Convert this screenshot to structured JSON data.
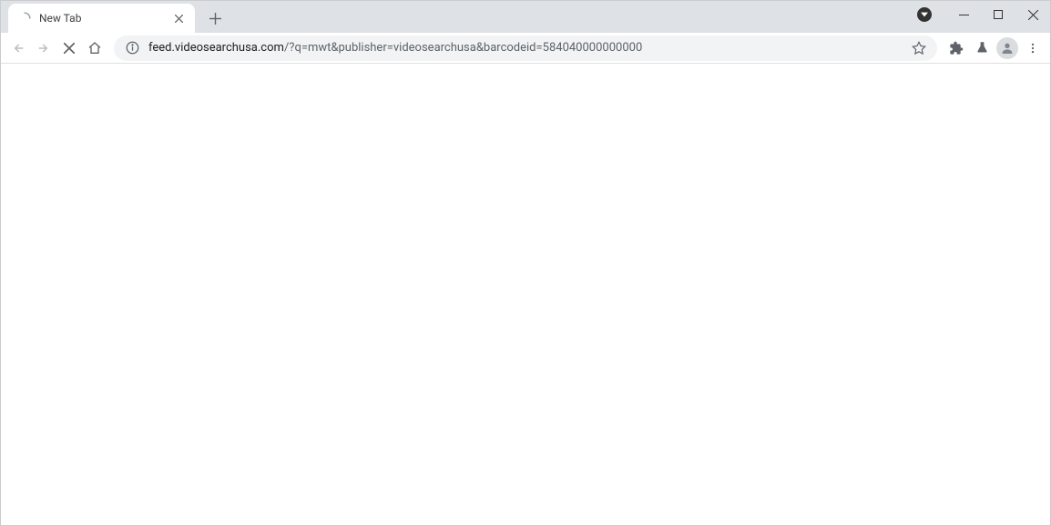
{
  "tab": {
    "title": "New Tab"
  },
  "url": {
    "domain": "feed.videosearchusa.com",
    "path": "/?q=mwt&publisher=videosearchusa&barcodeid=584040000000000"
  }
}
